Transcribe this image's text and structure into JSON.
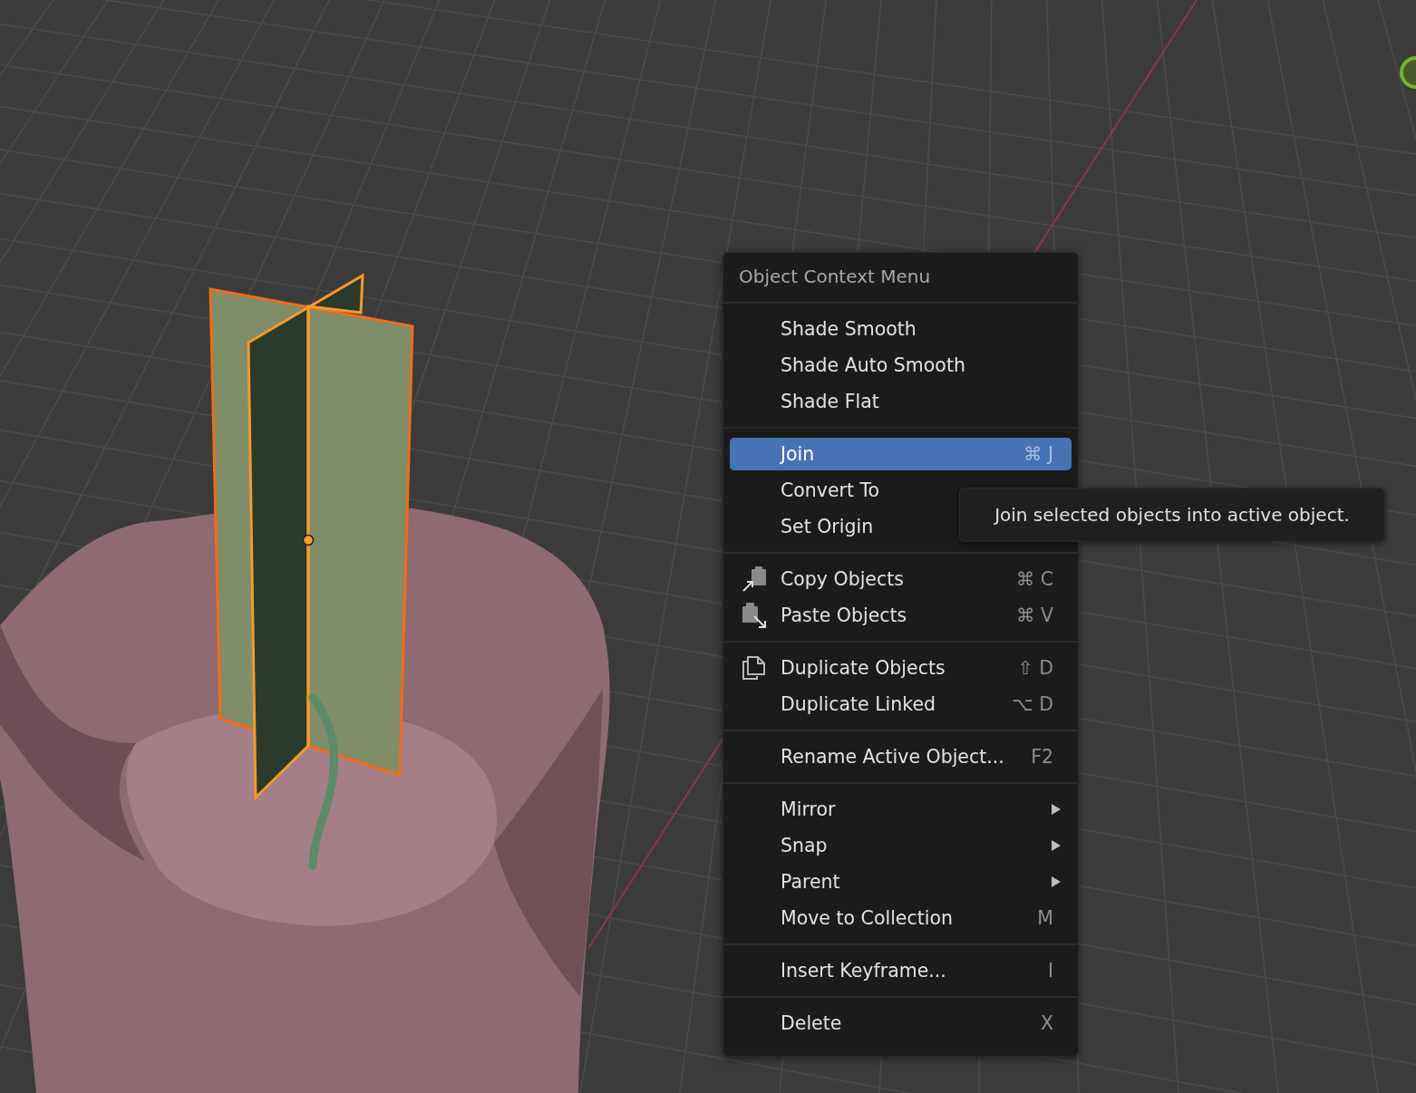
{
  "menu": {
    "title": "Object Context Menu",
    "sections": [
      {
        "items": [
          {
            "kind": "plain",
            "label": "Shade Smooth",
            "selected": false
          },
          {
            "kind": "plain",
            "label": "Shade Auto Smooth",
            "selected": false
          },
          {
            "kind": "plain",
            "label": "Shade Flat",
            "selected": false
          }
        ]
      },
      {
        "items": [
          {
            "kind": "plain",
            "label": "Join",
            "shortcut": "⌘ J",
            "selected": true
          },
          {
            "kind": "plain",
            "label": "Convert To",
            "selected": false
          },
          {
            "kind": "plain",
            "label": "Set Origin",
            "selected": false
          }
        ]
      },
      {
        "items": [
          {
            "kind": "copy",
            "label": "Copy Objects",
            "shortcut": "⌘ C",
            "selected": false
          },
          {
            "kind": "paste",
            "label": "Paste Objects",
            "shortcut": "⌘ V",
            "selected": false
          }
        ]
      },
      {
        "items": [
          {
            "kind": "duplicate",
            "label": "Duplicate Objects",
            "shortcut": "⇧ D",
            "selected": false
          },
          {
            "kind": "plain",
            "label": "Duplicate Linked",
            "shortcut": "⌥ D",
            "selected": false
          }
        ]
      },
      {
        "items": [
          {
            "kind": "plain",
            "label": "Rename Active Object...",
            "shortcut": "F2",
            "selected": false
          }
        ]
      },
      {
        "items": [
          {
            "kind": "submenu",
            "label": "Mirror",
            "selected": false
          },
          {
            "kind": "submenu",
            "label": "Snap",
            "selected": false
          },
          {
            "kind": "submenu",
            "label": "Parent",
            "selected": false
          },
          {
            "kind": "plain",
            "label": "Move to Collection",
            "shortcut": "M",
            "selected": false
          }
        ]
      },
      {
        "items": [
          {
            "kind": "plain",
            "label": "Insert Keyframe...",
            "shortcut": "I",
            "selected": false
          }
        ]
      },
      {
        "items": [
          {
            "kind": "plain",
            "label": "Delete",
            "shortcut": "X",
            "selected": false
          }
        ]
      }
    ]
  },
  "tooltip": {
    "text": "Join selected objects into active object."
  }
}
